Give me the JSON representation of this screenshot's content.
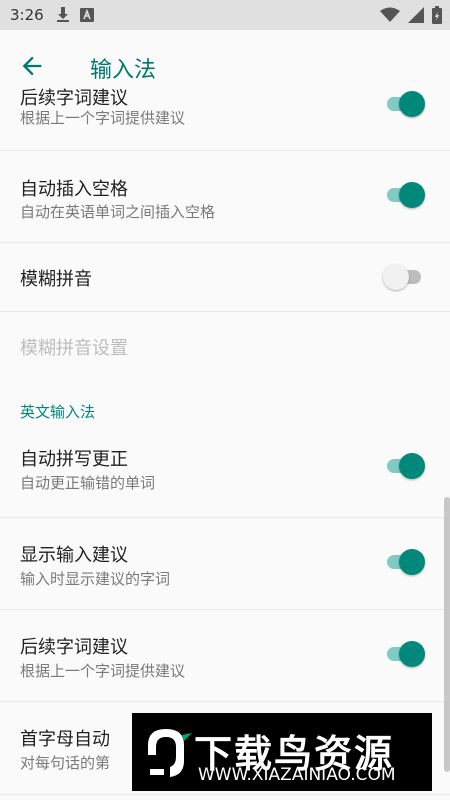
{
  "status_bar": {
    "time": "3:26",
    "left_icons": [
      "download-icon",
      "a-letter-icon"
    ],
    "right_icons": [
      "wifi-icon",
      "cellular-icon",
      "battery-icon"
    ]
  },
  "app_bar": {
    "title": "输入法",
    "back_icon": "arrow-back-icon"
  },
  "settings": {
    "partial_top": {
      "title": "后续字词建议",
      "subtitle": "根据上一个字词提供建议",
      "enabled": true
    },
    "auto_space": {
      "title": "自动插入空格",
      "subtitle": "自动在英语单词之间插入空格",
      "enabled": true
    },
    "fuzzy_pinyin": {
      "title": "模糊拼音",
      "enabled": false
    },
    "fuzzy_pinyin_settings": {
      "title": "模糊拼音设置"
    },
    "section_english": {
      "title": "英文输入法"
    },
    "auto_correct": {
      "title": "自动拼写更正",
      "subtitle": "自动更正输错的单词",
      "enabled": true
    },
    "show_suggestions": {
      "title": "显示输入建议",
      "subtitle": "输入时显示建议的字词",
      "enabled": true
    },
    "next_word": {
      "title": "后续字词建议",
      "subtitle": "根据上一个字词提供建议",
      "enabled": true
    },
    "auto_cap": {
      "title": "首字母自动",
      "subtitle": "对每句话的第"
    }
  },
  "watermark": {
    "brand": "下载鸟资源",
    "url": "WWW.XIAZAINIAO.COM"
  },
  "colors": {
    "accent": "#00897b",
    "accent_track": "#80cbc4",
    "title": "#00796b",
    "status_bar": "#e0e0e0"
  }
}
